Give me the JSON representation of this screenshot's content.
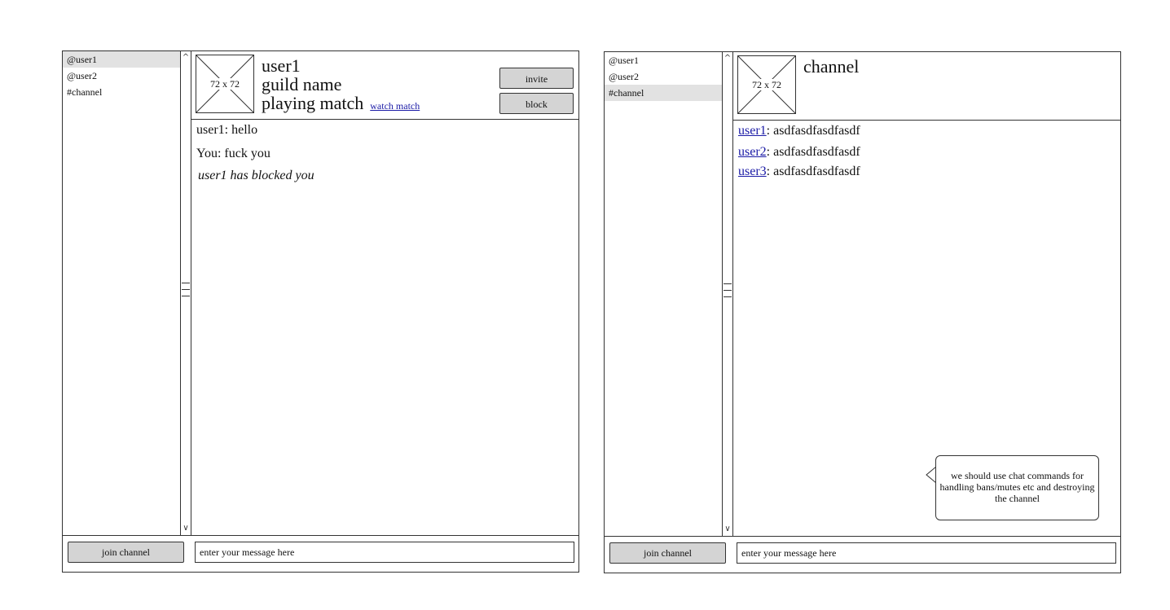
{
  "left_window": {
    "sidebar": {
      "items": [
        {
          "label": "@user1",
          "active": true
        },
        {
          "label": "@user2",
          "active": false
        },
        {
          "label": "#channel",
          "active": false
        }
      ]
    },
    "header": {
      "avatar_label": "72 x 72",
      "name": "user1",
      "guild": "guild name",
      "status": "playing match",
      "watch_link": "watch match",
      "invite_label": "invite",
      "block_label": "block"
    },
    "messages": {
      "m1_sender": "user1",
      "m1_text": ": hello",
      "m2_sender": "You",
      "m2_text": ": fuck you",
      "system": "user1 has blocked you"
    },
    "bottom": {
      "join_label": "join channel",
      "input_placeholder": "enter your message here"
    }
  },
  "right_window": {
    "sidebar": {
      "items": [
        {
          "label": "@user1",
          "active": false
        },
        {
          "label": "@user2",
          "active": false
        },
        {
          "label": "#channel",
          "active": true
        }
      ]
    },
    "header": {
      "avatar_label": "72 x 72",
      "title": "channel"
    },
    "messages": [
      {
        "user": "user1",
        "text": ": asdfasdfasdfasdf"
      },
      {
        "user": "user2",
        "text": ": asdfasdfasdfasdf"
      },
      {
        "user": "user3",
        "text": ": asdfasdfasdfasdf"
      }
    ],
    "callout": "we should use chat commands for handling bans/mutes etc and destroying the channel",
    "bottom": {
      "join_label": "join channel",
      "input_placeholder": "enter your message here"
    }
  },
  "colors": {
    "link": "#1a1aa6",
    "button_bg": "#d4d4d4",
    "selected_bg": "#e2e2e2"
  },
  "icons": [
    "scroll-up-icon",
    "scroll-down-icon",
    "scroll-grip-icon",
    "image-placeholder-icon",
    "callout-tail-icon"
  ]
}
